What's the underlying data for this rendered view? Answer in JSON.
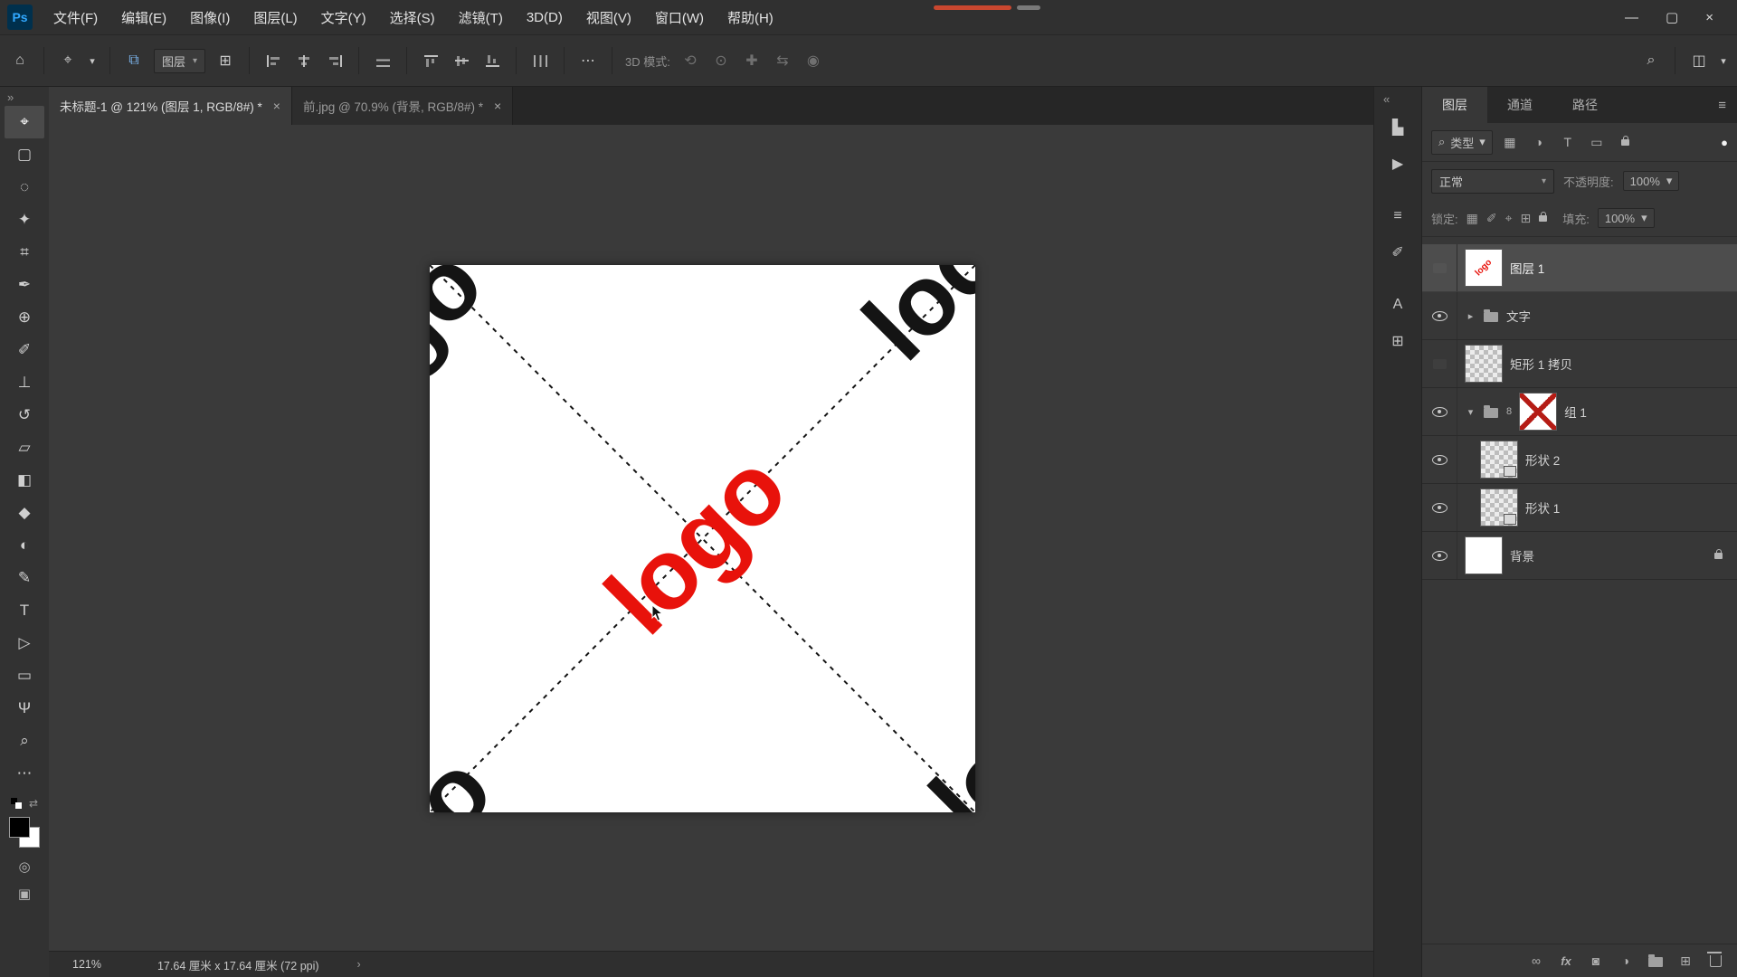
{
  "glyphs": {
    "caret": "▾",
    "ellipsis": "⋯",
    "search": "⌕",
    "menu": "≡",
    "close": "×",
    "collapse_right": "»",
    "collapse_left": "«",
    "chevron": "›"
  },
  "menubar": {
    "logo_text": "Ps",
    "items": [
      "文件(F)",
      "编辑(E)",
      "图像(I)",
      "图层(L)",
      "文字(Y)",
      "选择(S)",
      "滤镜(T)",
      "3D(D)",
      "视图(V)",
      "窗口(W)",
      "帮助(H)"
    ],
    "window_controls": {
      "minimize": "—",
      "maximize": "▢",
      "close": "×"
    }
  },
  "optionsbar": {
    "home_icon": "⌂",
    "tool_icon": "⌖",
    "autoselect_icon": "⧉",
    "autoselect_label": "图层",
    "transform_icon": "⊞",
    "threed_label": "3D 模式:",
    "threed_icons": [
      "⟲",
      "⊙",
      "✚",
      "⇆",
      "◉"
    ],
    "workspace_icon": "◫"
  },
  "tabs": [
    {
      "title": "未标题-1 @ 121% (图层 1, RGB/8#) *",
      "active": true
    },
    {
      "title": "前.jpg @ 70.9% (背景, RGB/8#) *",
      "active": false
    }
  ],
  "toolbar": {
    "tools": [
      {
        "name": "move-tool",
        "glyph": "⌖"
      },
      {
        "name": "marquee-tool",
        "glyph": "▢"
      },
      {
        "name": "lasso-tool",
        "glyph": "◌"
      },
      {
        "name": "quick-select-tool",
        "glyph": "✦"
      },
      {
        "name": "crop-tool",
        "glyph": "⌗"
      },
      {
        "name": "eyedropper-tool",
        "glyph": "✒"
      },
      {
        "name": "healing-brush-tool",
        "glyph": "⊕"
      },
      {
        "name": "brush-tool",
        "glyph": "✐"
      },
      {
        "name": "clone-stamp-tool",
        "glyph": "⊥"
      },
      {
        "name": "history-brush-tool",
        "glyph": "↺"
      },
      {
        "name": "eraser-tool",
        "glyph": "▱"
      },
      {
        "name": "gradient-tool",
        "glyph": "◧"
      },
      {
        "name": "blur-tool",
        "glyph": "◆"
      },
      {
        "name": "dodge-tool",
        "glyph": "◐"
      },
      {
        "name": "pen-tool",
        "glyph": "✎"
      },
      {
        "name": "type-tool",
        "glyph": "T"
      },
      {
        "name": "path-select-tool",
        "glyph": "▷"
      },
      {
        "name": "shape-tool",
        "glyph": "▭"
      },
      {
        "name": "hand-tool",
        "glyph": "Ψ"
      },
      {
        "name": "zoom-tool",
        "glyph": "⌕"
      },
      {
        "name": "edit-toolbar",
        "glyph": "⋯"
      }
    ],
    "swap_icon": "⇄",
    "quickmask_icon": "◎",
    "screenmode_icon": "▣",
    "fg_color": "#000000",
    "bg_color": "#ffffff"
  },
  "canvas": {
    "logo_text": "logo",
    "logo_color": "#e8120b",
    "corner_color": "#141414"
  },
  "dock_strip": {
    "buttons": [
      {
        "name": "histogram",
        "glyph": "▙"
      },
      {
        "name": "actions-play",
        "glyph": "▶"
      },
      {
        "name": "properties",
        "glyph": "≡"
      },
      {
        "name": "brush-settings",
        "glyph": "✐"
      },
      {
        "name": "character",
        "glyph": "A"
      },
      {
        "name": "libraries",
        "glyph": "⊞"
      }
    ]
  },
  "panel": {
    "tabs": [
      "图层",
      "通道",
      "路径"
    ],
    "filter": {
      "type_label": "类型",
      "pixel_icon": "▦",
      "adjust_icon": "◑",
      "type_icon": "T",
      "shape_icon": "▭",
      "toggle_dot": "●"
    },
    "blend": {
      "mode": "正常",
      "opacity_label": "不透明度:",
      "opacity_value": "100%"
    },
    "lock": {
      "label": "锁定:",
      "transparent_icon": "▦",
      "paint_icon": "✐",
      "move_icon": "⌖",
      "artboard_icon": "⊞",
      "fill_label": "填充:",
      "fill_value": "100%"
    },
    "layers": [
      {
        "name": "图层 1"
      },
      {
        "name": "文字",
        "expander": "▸"
      },
      {
        "name": "矩形 1 拷贝"
      },
      {
        "name": "组 1",
        "expander": "▾",
        "chain": "8"
      },
      {
        "name": "形状 2"
      },
      {
        "name": "形状 1"
      },
      {
        "name": "背景"
      }
    ],
    "footer": {
      "link": "∞",
      "fx": "fx",
      "mask": "◙",
      "adjust": "◑",
      "new_layer": "⊞"
    }
  },
  "statusbar": {
    "zoom": "121%",
    "doc_info": "17.64 厘米 x 17.64 厘米 (72 ppi)"
  }
}
